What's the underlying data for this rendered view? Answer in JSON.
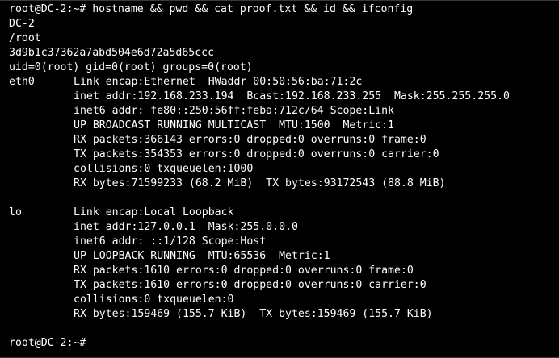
{
  "prompt": {
    "first": "root@DC-2:~# ",
    "command": "hostname && pwd && cat proof.txt && id && ifconfig",
    "last": "root@DC-2:~#"
  },
  "output": {
    "hostname": "DC-2",
    "pwd": "/root",
    "proof": "3d9b1c37362a7abd504e6d72a5d65ccc",
    "id": "uid=0(root) gid=0(root) groups=0(root)"
  },
  "interfaces": [
    {
      "name": "eth0",
      "lines": [
        "Link encap:Ethernet  HWaddr 00:50:56:ba:71:2c",
        "inet addr:192.168.233.194  Bcast:192.168.233.255  Mask:255.255.255.0",
        "inet6 addr: fe80::250:56ff:feba:712c/64 Scope:Link",
        "UP BROADCAST RUNNING MULTICAST  MTU:1500  Metric:1",
        "RX packets:366143 errors:0 dropped:0 overruns:0 frame:0",
        "TX packets:354353 errors:0 dropped:0 overruns:0 carrier:0",
        "collisions:0 txqueuelen:1000",
        "RX bytes:71599233 (68.2 MiB)  TX bytes:93172543 (88.8 MiB)"
      ]
    },
    {
      "name": "lo",
      "lines": [
        "Link encap:Local Loopback",
        "inet addr:127.0.0.1  Mask:255.0.0.0",
        "inet6 addr: ::1/128 Scope:Host",
        "UP LOOPBACK RUNNING  MTU:65536  Metric:1",
        "RX packets:1610 errors:0 dropped:0 overruns:0 frame:0",
        "TX packets:1610 errors:0 dropped:0 overruns:0 carrier:0",
        "collisions:0 txqueuelen:0",
        "RX bytes:159469 (155.7 KiB)  TX bytes:159469 (155.7 KiB)"
      ]
    }
  ],
  "colors": {
    "background": "#000000",
    "text": "#ffffff"
  }
}
